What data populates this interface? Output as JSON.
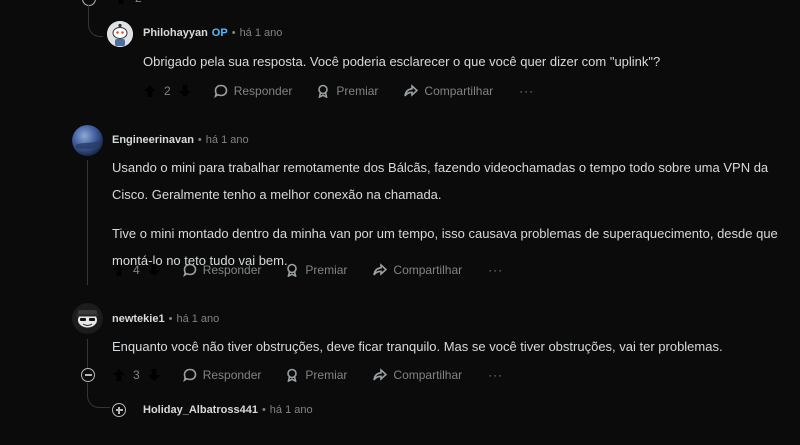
{
  "actions": {
    "reply": "Responder",
    "award": "Premiar",
    "share": "Compartilhar",
    "more": "···"
  },
  "top_partial": {
    "count": "2"
  },
  "comments": [
    {
      "author": "Philohayyan",
      "badge": "OP",
      "time": "há 1 ano",
      "paragraphs": [
        "Obrigado pela sua resposta. Você poderia esclarecer o que você quer dizer com \"uplink\"?"
      ],
      "votes": "2"
    },
    {
      "author": "Engineerinavan",
      "time": "há 1 ano",
      "paragraphs": [
        "Usando o mini para trabalhar remotamente dos Bálcãs, fazendo videochamadas o tempo todo sobre uma VPN da Cisco. Geralmente tenho a melhor conexão na chamada.",
        "Tive o mini montado dentro da minha van por um tempo, isso causava problemas de superaquecimento, desde que montá-lo no teto tudo vai bem."
      ],
      "votes": "4"
    },
    {
      "author": "newtekie1",
      "time": "há 1 ano",
      "paragraphs": [
        "Enquanto você não tiver obstruções, deve ficar tranquilo. Mas se você tiver obstruções, vai ter problemas."
      ],
      "votes": "3"
    },
    {
      "author": "Holiday_Albatross441",
      "time": "há 1 ano"
    }
  ]
}
